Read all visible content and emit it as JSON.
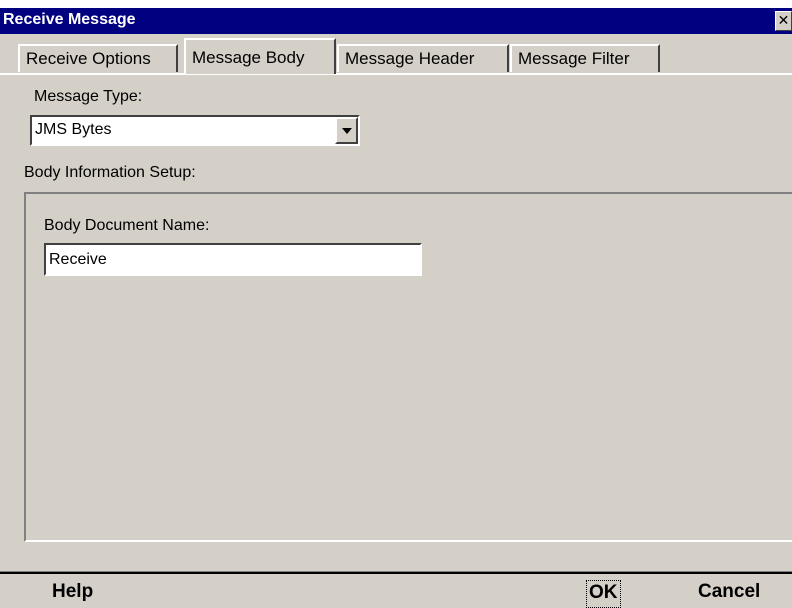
{
  "window": {
    "title": "Receive Message",
    "close_glyph": "✕"
  },
  "tabs": [
    {
      "label": "Receive Options",
      "active": false
    },
    {
      "label": "Message Body",
      "active": true
    },
    {
      "label": "Message Header",
      "active": false
    },
    {
      "label": "Message Filter",
      "active": false
    }
  ],
  "message_type": {
    "label": "Message Type:",
    "value": "JMS Bytes"
  },
  "body_setup": {
    "label": "Body Information Setup:",
    "doc_name_label": "Body Document Name:",
    "doc_name_value": "Receive"
  },
  "footer": {
    "help": "Help",
    "ok": "OK",
    "cancel": "Cancel"
  },
  "colors": {
    "titlebar": "#000080",
    "dialog_bg": "#d4d0c8"
  }
}
